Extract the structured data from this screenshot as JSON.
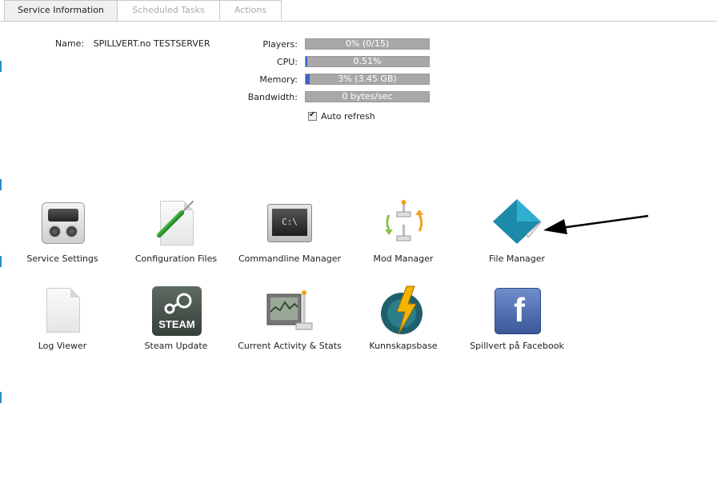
{
  "tabs": [
    {
      "label": "Service Information",
      "active": true
    },
    {
      "label": "Scheduled Tasks",
      "active": false
    },
    {
      "label": "Actions",
      "active": false
    }
  ],
  "service": {
    "name_label": "Name:",
    "name_value": "SPILLVERT.no TESTSERVER"
  },
  "stats": {
    "players": {
      "label": "Players:",
      "text": "0% (0/15)",
      "percent": 0
    },
    "cpu": {
      "label": "CPU:",
      "text": "0.51%",
      "percent": 0.51
    },
    "memory": {
      "label": "Memory:",
      "text": "3% (3.45 GB)",
      "percent": 3
    },
    "bandwidth": {
      "label": "Bandwidth:",
      "text": "0 bytes/sec",
      "percent": 0
    }
  },
  "auto_refresh": {
    "label": "Auto refresh",
    "checked": true
  },
  "tools": [
    {
      "label": "Service Settings",
      "icon": "service-settings-icon"
    },
    {
      "label": "Configuration Files",
      "icon": "configuration-files-icon"
    },
    {
      "label": "Commandline Manager",
      "icon": "commandline-icon",
      "icon_text": "C:\\"
    },
    {
      "label": "Mod Manager",
      "icon": "mod-manager-icon"
    },
    {
      "label": "File Manager",
      "icon": "file-manager-icon"
    },
    {
      "label": "Log Viewer",
      "icon": "log-viewer-icon"
    },
    {
      "label": "Steam Update",
      "icon": "steam-icon",
      "icon_text": "STEAM"
    },
    {
      "label": "Current Activity & Stats",
      "icon": "activity-stats-icon"
    },
    {
      "label": "Kunnskapsbase",
      "icon": "knowledge-base-icon"
    },
    {
      "label": "Spillvert på Facebook",
      "icon": "facebook-icon",
      "icon_text": "f"
    }
  ],
  "colors": {
    "bar_bg": "#a8a8a8",
    "bar_fill": "#3a64c8",
    "accent_edge": "#2a8fd0",
    "file_manager_teal": "#1c8aa8"
  }
}
